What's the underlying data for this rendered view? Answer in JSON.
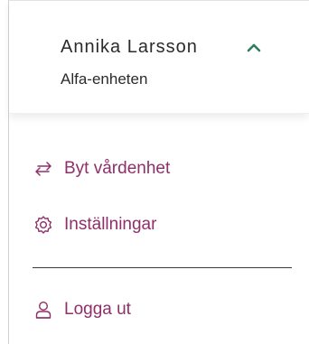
{
  "user_menu": {
    "user_name": "Annika Larsson",
    "unit_name": "Alfa-enheten",
    "items": [
      {
        "label": "Byt vårdenhet",
        "icon": "switch-arrows-icon"
      },
      {
        "label": "Inställningar",
        "icon": "gear-icon"
      },
      {
        "label": "Logga ut",
        "icon": "user-logout-icon"
      }
    ]
  },
  "colors": {
    "accent": "#8f2f6a",
    "chevron": "#2e7d5b",
    "text": "#2b2b2b",
    "divider": "#3a3a3a"
  }
}
